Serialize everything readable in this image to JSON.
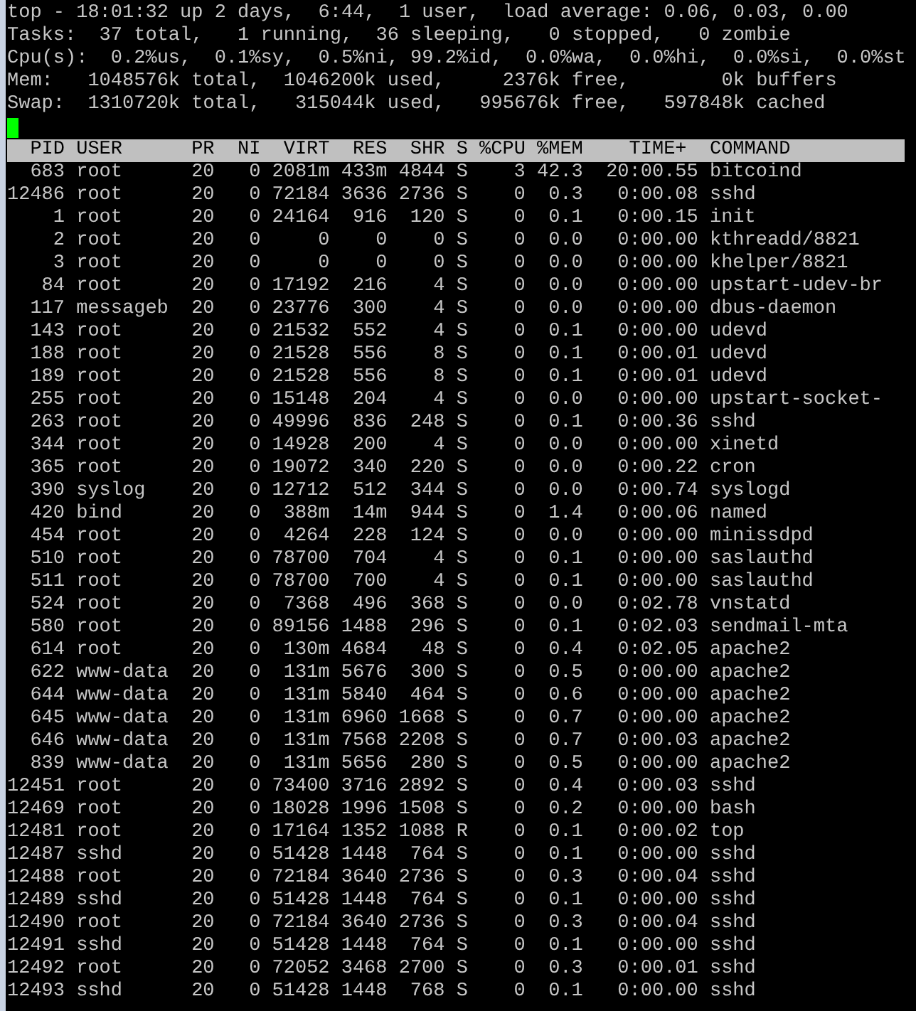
{
  "summary_lines": [
    "top - 18:01:32 up 2 days,  6:44,  1 user,  load average: 0.06, 0.03, 0.00",
    "Tasks:  37 total,   1 running,  36 sleeping,   0 stopped,   0 zombie",
    "Cpu(s):  0.2%us,  0.1%sy,  0.5%ni, 99.2%id,  0.0%wa,  0.0%hi,  0.0%si,  0.0%st",
    "Mem:   1048576k total,  1046200k used,     2376k free,        0k buffers",
    "Swap:  1310720k total,   315044k used,   995676k free,   597848k cached"
  ],
  "table": {
    "columns": [
      "PID",
      "USER",
      "PR",
      "NI",
      "VIRT",
      "RES",
      "SHR",
      "S",
      "%CPU",
      "%MEM",
      "TIME+",
      "COMMAND"
    ],
    "rows": [
      [
        "683",
        "root",
        "20",
        "0",
        "2081m",
        "433m",
        "4844",
        "S",
        "3",
        "42.3",
        "20:00.55",
        "bitcoind"
      ],
      [
        "12486",
        "root",
        "20",
        "0",
        "72184",
        "3636",
        "2736",
        "S",
        "0",
        "0.3",
        "0:00.08",
        "sshd"
      ],
      [
        "1",
        "root",
        "20",
        "0",
        "24164",
        "916",
        "120",
        "S",
        "0",
        "0.1",
        "0:00.15",
        "init"
      ],
      [
        "2",
        "root",
        "20",
        "0",
        "0",
        "0",
        "0",
        "S",
        "0",
        "0.0",
        "0:00.00",
        "kthreadd/8821"
      ],
      [
        "3",
        "root",
        "20",
        "0",
        "0",
        "0",
        "0",
        "S",
        "0",
        "0.0",
        "0:00.00",
        "khelper/8821"
      ],
      [
        "84",
        "root",
        "20",
        "0",
        "17192",
        "216",
        "4",
        "S",
        "0",
        "0.0",
        "0:00.00",
        "upstart-udev-br"
      ],
      [
        "117",
        "messageb",
        "20",
        "0",
        "23776",
        "300",
        "4",
        "S",
        "0",
        "0.0",
        "0:00.00",
        "dbus-daemon"
      ],
      [
        "143",
        "root",
        "20",
        "0",
        "21532",
        "552",
        "4",
        "S",
        "0",
        "0.1",
        "0:00.00",
        "udevd"
      ],
      [
        "188",
        "root",
        "20",
        "0",
        "21528",
        "556",
        "8",
        "S",
        "0",
        "0.1",
        "0:00.01",
        "udevd"
      ],
      [
        "189",
        "root",
        "20",
        "0",
        "21528",
        "556",
        "8",
        "S",
        "0",
        "0.1",
        "0:00.01",
        "udevd"
      ],
      [
        "255",
        "root",
        "20",
        "0",
        "15148",
        "204",
        "4",
        "S",
        "0",
        "0.0",
        "0:00.00",
        "upstart-socket-"
      ],
      [
        "263",
        "root",
        "20",
        "0",
        "49996",
        "836",
        "248",
        "S",
        "0",
        "0.1",
        "0:00.36",
        "sshd"
      ],
      [
        "344",
        "root",
        "20",
        "0",
        "14928",
        "200",
        "4",
        "S",
        "0",
        "0.0",
        "0:00.00",
        "xinetd"
      ],
      [
        "365",
        "root",
        "20",
        "0",
        "19072",
        "340",
        "220",
        "S",
        "0",
        "0.0",
        "0:00.22",
        "cron"
      ],
      [
        "390",
        "syslog",
        "20",
        "0",
        "12712",
        "512",
        "344",
        "S",
        "0",
        "0.0",
        "0:00.74",
        "syslogd"
      ],
      [
        "420",
        "bind",
        "20",
        "0",
        "388m",
        "14m",
        "944",
        "S",
        "0",
        "1.4",
        "0:00.06",
        "named"
      ],
      [
        "454",
        "root",
        "20",
        "0",
        "4264",
        "228",
        "124",
        "S",
        "0",
        "0.0",
        "0:00.00",
        "minissdpd"
      ],
      [
        "510",
        "root",
        "20",
        "0",
        "78700",
        "704",
        "4",
        "S",
        "0",
        "0.1",
        "0:00.00",
        "saslauthd"
      ],
      [
        "511",
        "root",
        "20",
        "0",
        "78700",
        "700",
        "4",
        "S",
        "0",
        "0.1",
        "0:00.00",
        "saslauthd"
      ],
      [
        "524",
        "root",
        "20",
        "0",
        "7368",
        "496",
        "368",
        "S",
        "0",
        "0.0",
        "0:02.78",
        "vnstatd"
      ],
      [
        "580",
        "root",
        "20",
        "0",
        "89156",
        "1488",
        "296",
        "S",
        "0",
        "0.1",
        "0:02.03",
        "sendmail-mta"
      ],
      [
        "614",
        "root",
        "20",
        "0",
        "130m",
        "4684",
        "48",
        "S",
        "0",
        "0.4",
        "0:02.05",
        "apache2"
      ],
      [
        "622",
        "www-data",
        "20",
        "0",
        "131m",
        "5676",
        "300",
        "S",
        "0",
        "0.5",
        "0:00.00",
        "apache2"
      ],
      [
        "644",
        "www-data",
        "20",
        "0",
        "131m",
        "5840",
        "464",
        "S",
        "0",
        "0.6",
        "0:00.00",
        "apache2"
      ],
      [
        "645",
        "www-data",
        "20",
        "0",
        "131m",
        "6960",
        "1668",
        "S",
        "0",
        "0.7",
        "0:00.00",
        "apache2"
      ],
      [
        "646",
        "www-data",
        "20",
        "0",
        "131m",
        "7568",
        "2208",
        "S",
        "0",
        "0.7",
        "0:00.03",
        "apache2"
      ],
      [
        "839",
        "www-data",
        "20",
        "0",
        "131m",
        "5656",
        "280",
        "S",
        "0",
        "0.5",
        "0:00.00",
        "apache2"
      ],
      [
        "12451",
        "root",
        "20",
        "0",
        "73400",
        "3716",
        "2892",
        "S",
        "0",
        "0.4",
        "0:00.03",
        "sshd"
      ],
      [
        "12469",
        "root",
        "20",
        "0",
        "18028",
        "1996",
        "1508",
        "S",
        "0",
        "0.2",
        "0:00.00",
        "bash"
      ],
      [
        "12481",
        "root",
        "20",
        "0",
        "17164",
        "1352",
        "1088",
        "R",
        "0",
        "0.1",
        "0:00.02",
        "top"
      ],
      [
        "12487",
        "sshd",
        "20",
        "0",
        "51428",
        "1448",
        "764",
        "S",
        "0",
        "0.1",
        "0:00.00",
        "sshd"
      ],
      [
        "12488",
        "root",
        "20",
        "0",
        "72184",
        "3640",
        "2736",
        "S",
        "0",
        "0.3",
        "0:00.04",
        "sshd"
      ],
      [
        "12489",
        "sshd",
        "20",
        "0",
        "51428",
        "1448",
        "764",
        "S",
        "0",
        "0.1",
        "0:00.00",
        "sshd"
      ],
      [
        "12490",
        "root",
        "20",
        "0",
        "72184",
        "3640",
        "2736",
        "S",
        "0",
        "0.3",
        "0:00.04",
        "sshd"
      ],
      [
        "12491",
        "sshd",
        "20",
        "0",
        "51428",
        "1448",
        "764",
        "S",
        "0",
        "0.1",
        "0:00.00",
        "sshd"
      ],
      [
        "12492",
        "root",
        "20",
        "0",
        "72052",
        "3468",
        "2700",
        "S",
        "0",
        "0.3",
        "0:00.01",
        "sshd"
      ],
      [
        "12493",
        "sshd",
        "20",
        "0",
        "51428",
        "1448",
        "768",
        "S",
        "0",
        "0.1",
        "0:00.00",
        "sshd"
      ]
    ]
  }
}
